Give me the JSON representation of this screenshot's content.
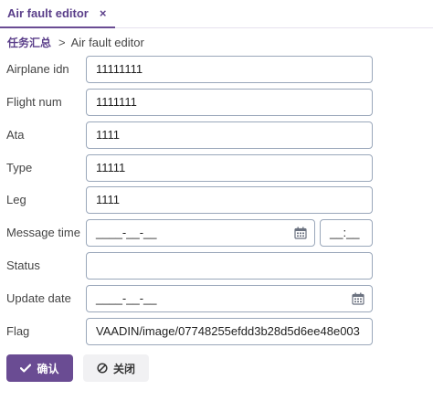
{
  "tab": {
    "title": "Air fault editor",
    "close_glyph": "×"
  },
  "breadcrumb": {
    "root": "任务汇总",
    "separator": ">",
    "current": "Air fault editor"
  },
  "form": {
    "airplane_idn": {
      "label": "Airplane idn",
      "value": "11111111"
    },
    "flight_num": {
      "label": "Flight num",
      "value": "1111111"
    },
    "ata": {
      "label": "Ata",
      "value": "1111"
    },
    "type": {
      "label": "Type",
      "value": "11111"
    },
    "leg": {
      "label": "Leg",
      "value": "1111"
    },
    "message_time": {
      "label": "Message time",
      "date_value": "____-__-__",
      "time_value": "__:__",
      "icon": "calendar-icon"
    },
    "status": {
      "label": "Status",
      "value": ""
    },
    "update_date": {
      "label": "Update date",
      "date_value": "____-__-__",
      "icon": "calendar-icon"
    },
    "flag": {
      "label": "Flag",
      "value": "VAADIN/image/07748255efdd3b28d5d6ee48e003"
    }
  },
  "buttons": {
    "ok": {
      "label": "确认",
      "icon": "check-icon"
    },
    "close": {
      "label": "关闭",
      "icon": "ban-icon"
    }
  },
  "colors": {
    "accent": "#6a4c93",
    "field_border": "#9aa7ba",
    "secondary_button": "#f1f1f3"
  }
}
